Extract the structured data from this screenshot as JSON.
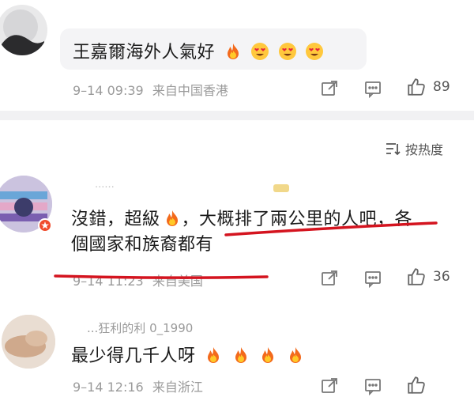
{
  "sort": {
    "label": "按热度"
  },
  "comments": [
    {
      "text": "王嘉爾海外人氣好",
      "emojis": [
        "fire-emoji",
        "heart-eyes-emoji",
        "heart-eyes-emoji",
        "heart-eyes-emoji"
      ],
      "time": "9–14 09:39",
      "location": "来自中国香港",
      "likes": "89"
    },
    {
      "username": "......",
      "text_before_emoji": "沒錯，超級",
      "emojis": [
        "fire-emoji"
      ],
      "text_after_emoji": "，大概排了兩公里的人吧，各",
      "text_line2": "個國家和族裔都有",
      "time": "9–14 11:23",
      "location": "来自美国",
      "likes": "36"
    },
    {
      "username": "...狂利的利 0_1990",
      "text": "最少得几千人呀",
      "emojis": [
        "fire-emoji",
        "fire-emoji",
        "fire-emoji",
        "fire-emoji"
      ],
      "time": "9–14 12:16",
      "location": "来自浙江"
    }
  ],
  "colors": {
    "annotation": "#d4141f",
    "meta": "#9a9a9a",
    "bubble": "#f4f4f6"
  }
}
